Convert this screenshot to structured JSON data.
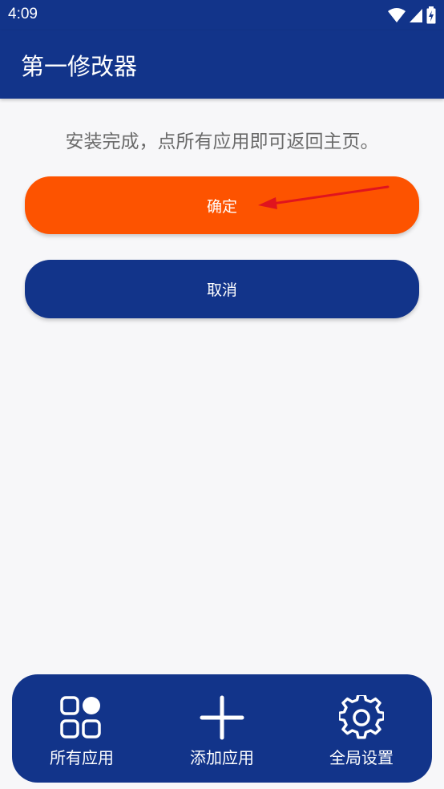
{
  "status_bar": {
    "time": "4:09",
    "icons": [
      "wifi-icon",
      "signal-icon",
      "battery-charging-icon"
    ]
  },
  "app_bar": {
    "title": "第一修改器"
  },
  "main": {
    "message": "安装完成，点所有应用即可返回主页。",
    "confirm_label": "确定",
    "cancel_label": "取消"
  },
  "bottom_nav": {
    "items": [
      {
        "label": "所有应用",
        "icon": "apps-grid-icon"
      },
      {
        "label": "添加应用",
        "icon": "plus-icon"
      },
      {
        "label": "全局设置",
        "icon": "gear-icon"
      }
    ]
  },
  "colors": {
    "primary": "#12348a",
    "accent": "#fd5300",
    "background": "#f7f7f9",
    "message_text": "#6b6b6b",
    "annotation_arrow": "#e0141e"
  }
}
